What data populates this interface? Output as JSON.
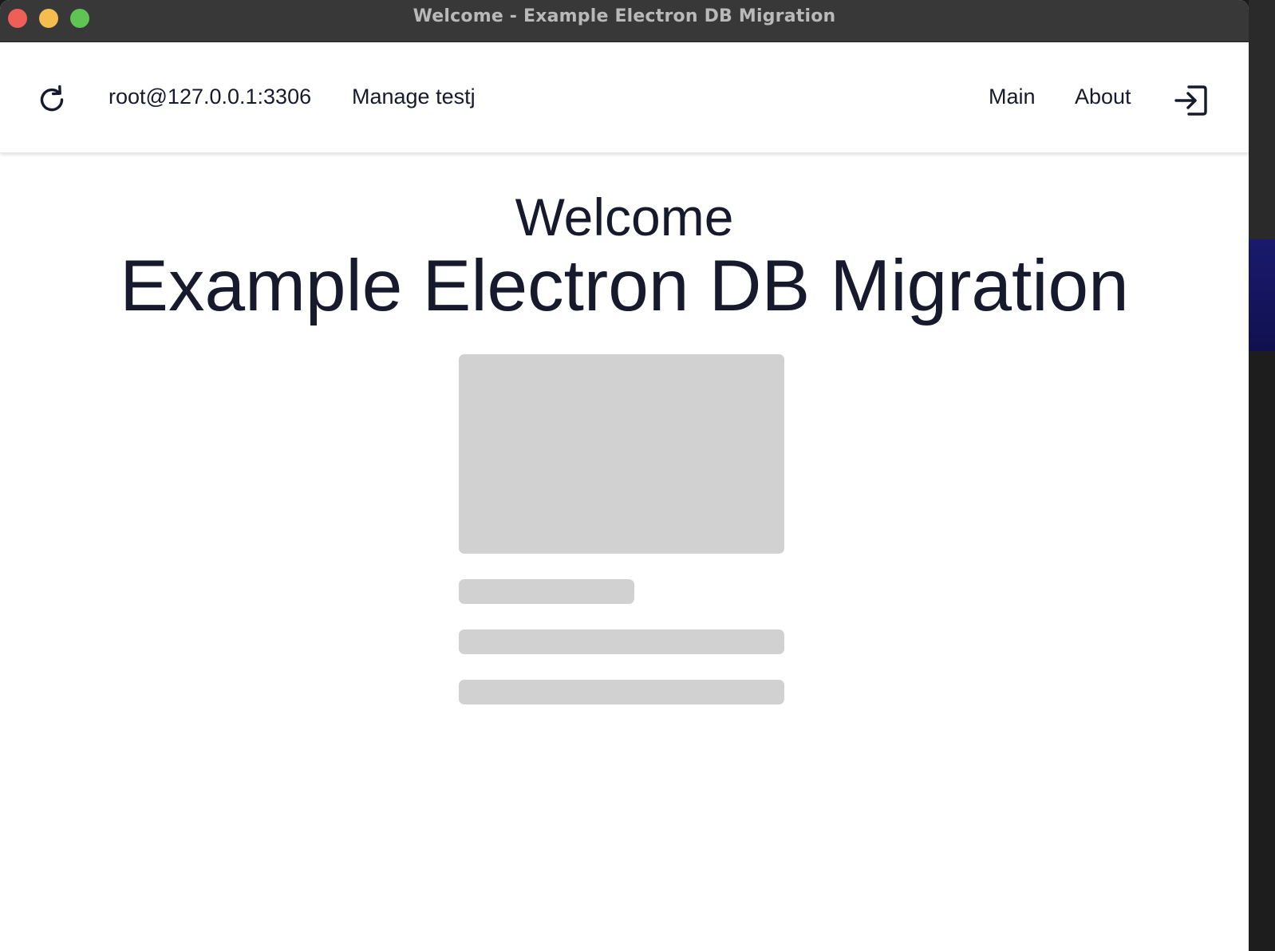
{
  "window": {
    "title": "Welcome - Example Electron DB Migration"
  },
  "navbar": {
    "refresh_icon": "refresh-icon",
    "connection": "root@127.0.0.1:3306",
    "manage_link": "Manage testj",
    "main_link": "Main",
    "about_link": "About",
    "logout_icon": "sign-out-icon"
  },
  "main": {
    "heading": "Welcome",
    "app_name": "Example Electron DB Migration"
  },
  "colors": {
    "text": "#161a2c",
    "skeleton": "#d1d1d1",
    "titlebar": "#383838"
  }
}
